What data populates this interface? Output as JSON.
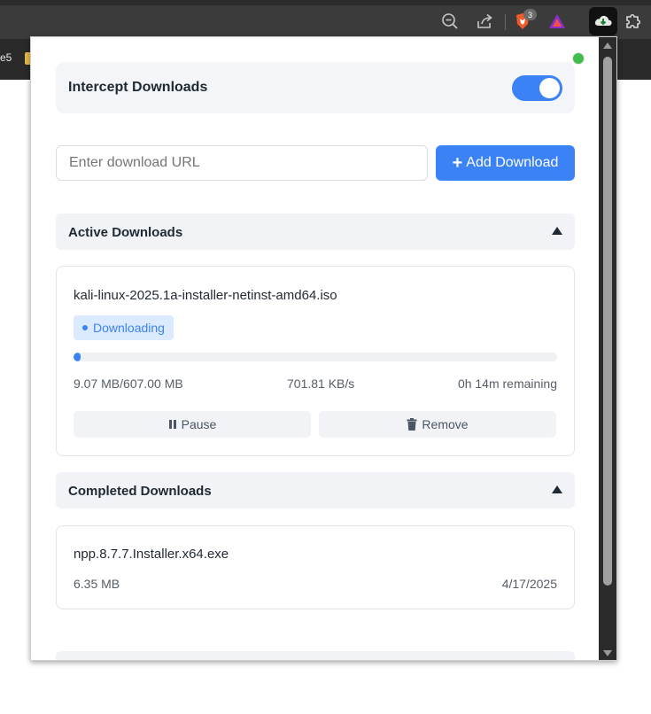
{
  "browser": {
    "bookmark_text": "e5",
    "brave_badge": "3"
  },
  "popup": {
    "intercept_label": "Intercept Downloads",
    "intercept_enabled": true,
    "url_placeholder": "Enter download URL",
    "add_button_label": "Add Download",
    "active_section_title": "Active Downloads",
    "completed_section_title": "Completed Downloads",
    "active": {
      "file_name": "kali-linux-2025.1a-installer-netinst-amd64.iso",
      "status": "Downloading",
      "progress_percent": 1.5,
      "size_text": "9.07 MB/607.00 MB",
      "speed_text": "701.81 KB/s",
      "remaining_text": "0h 14m remaining",
      "pause_label": "Pause",
      "remove_label": "Remove"
    },
    "completed": {
      "file_name": "npp.8.7.7.Installer.x64.exe",
      "size_text": "6.35 MB",
      "date_text": "4/17/2025"
    }
  },
  "colors": {
    "accent": "#3b82f6",
    "status_dot": "#3ebd4a"
  }
}
